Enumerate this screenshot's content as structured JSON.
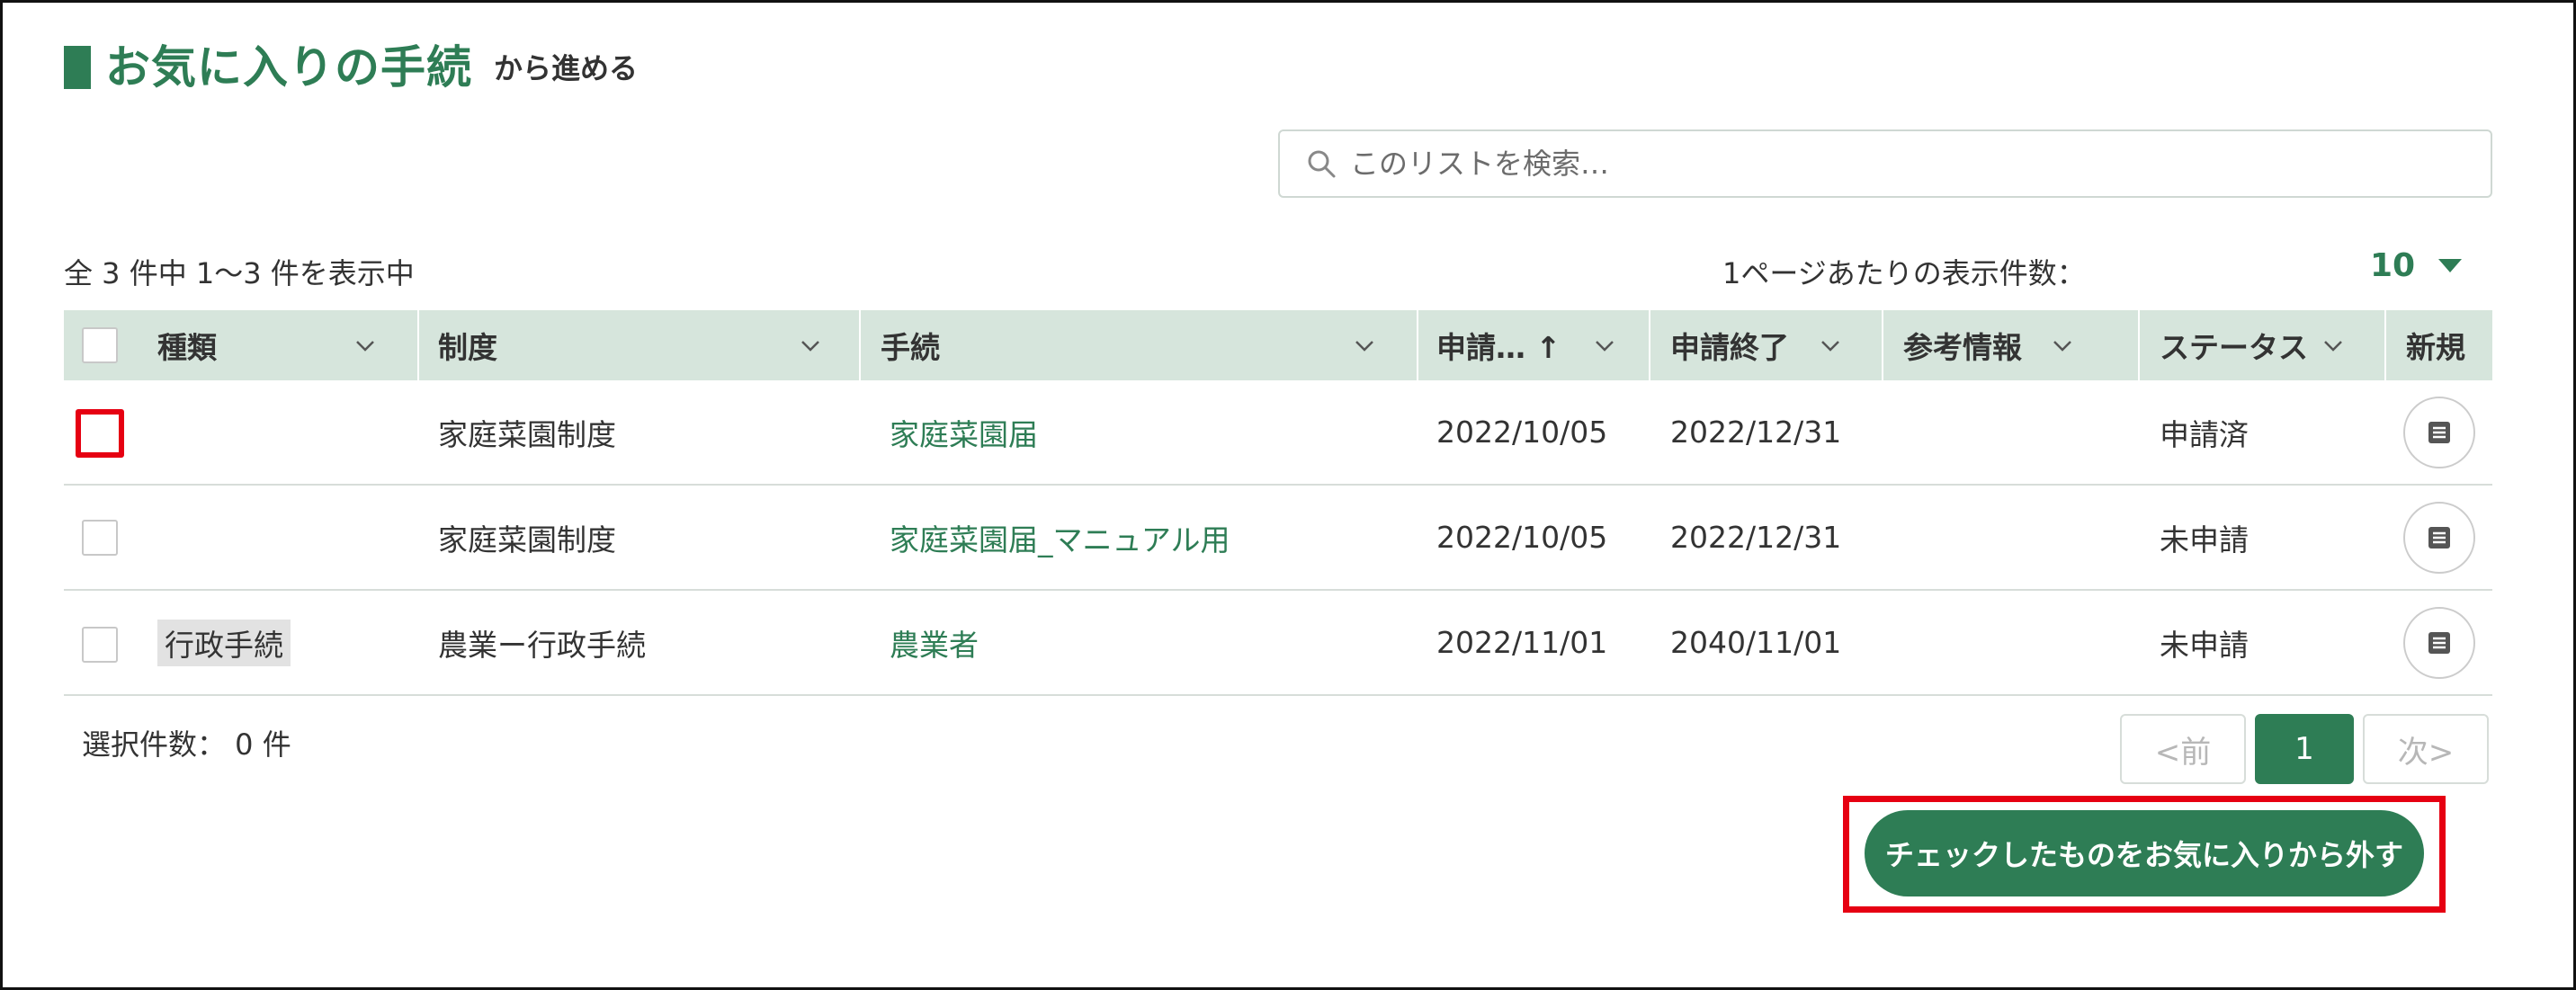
{
  "header": {
    "title": "お気に入りの手続",
    "subtitle": "から進める"
  },
  "search": {
    "placeholder": "このリストを検索…",
    "icon": "search-icon"
  },
  "summary": {
    "count_text": "全 3 件中 1～3 件を表示中",
    "per_page_label": "1ページあたりの表示件数：",
    "per_page_value": "10"
  },
  "table": {
    "columns": [
      "種類",
      "制度",
      "手続",
      "申請… ↑",
      "申請終了",
      "参考情報",
      "ステータス",
      "新規"
    ],
    "rows": [
      {
        "type": "",
        "system": "家庭菜園制度",
        "procedure": "家庭菜園届",
        "start": "2022/10/05",
        "end": "2022/12/31",
        "ref": "",
        "status": "申請済"
      },
      {
        "type": "",
        "system": "家庭菜園制度",
        "procedure": "家庭菜園届_マニュアル用",
        "start": "2022/10/05",
        "end": "2022/12/31",
        "ref": "",
        "status": "未申請"
      },
      {
        "type": "行政手続",
        "system": "農業ー行政手続",
        "procedure": "農業者",
        "start": "2022/11/01",
        "end": "2040/11/01",
        "ref": "",
        "status": "未申請"
      }
    ]
  },
  "footer": {
    "selected_count": "選択件数： 0 件",
    "pager": {
      "prev": "<前",
      "current": "1",
      "next": "次>"
    },
    "remove_button": "チェックしたものをお気に入りから外す"
  },
  "colors": {
    "accent": "#2e7d55",
    "header_bg": "#d6e5dc",
    "highlight": "#e60012"
  }
}
